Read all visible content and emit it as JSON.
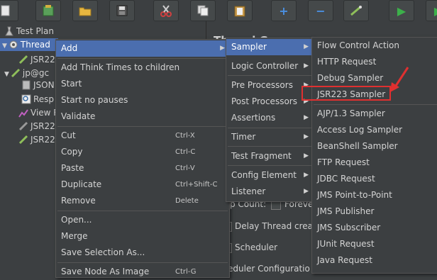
{
  "toolbar": {
    "buttons": [
      "new-icon",
      "templates-icon",
      "open-icon",
      "save-icon",
      "cut-icon",
      "copy-icon",
      "paste-icon",
      "expand-icon",
      "collapse-icon",
      "toggle-icon",
      "start-icon"
    ],
    "glyphs": {
      "expand": "+",
      "collapse": "−",
      "start": "▶"
    }
  },
  "tree": {
    "test_plan": "Test Plan",
    "thread": "Thread",
    "items": [
      "JSR22",
      "jp@gc",
      "JSON",
      "Resp",
      "View R",
      "JSR22",
      "JSR22"
    ]
  },
  "right_pane": {
    "title": "Thread G",
    "loop_count_label": "p Count:",
    "forever_label": "Foreve",
    "delay_label": "Delay Thread creati",
    "scheduler_label": "Scheduler",
    "scheduler_config_label": "eduler Configuratio",
    "partial_d": "d L"
  },
  "context_menu": {
    "items": [
      {
        "label": "Add",
        "submenu": true,
        "selected": true
      },
      {
        "label": "Add Think Times to children"
      },
      {
        "label": "Start"
      },
      {
        "label": "Start no pauses"
      },
      {
        "label": "Validate"
      },
      {
        "label": "Cut",
        "accel": "Ctrl-X"
      },
      {
        "label": "Copy",
        "accel": "Ctrl-C"
      },
      {
        "label": "Paste",
        "accel": "Ctrl-V"
      },
      {
        "label": "Duplicate",
        "accel": "Ctrl+Shift-C"
      },
      {
        "label": "Remove",
        "accel": "Delete"
      },
      {
        "label": "Open..."
      },
      {
        "label": "Merge"
      },
      {
        "label": "Save Selection As..."
      },
      {
        "label": "Save Node As Image",
        "accel": "Ctrl-G"
      }
    ]
  },
  "add_menu": {
    "items": [
      "Sampler",
      "Logic Controller",
      "Pre Processors",
      "Post Processors",
      "Assertions",
      "Timer",
      "Test Fragment",
      "Config Element",
      "Listener"
    ]
  },
  "sampler_menu": {
    "items": [
      "Flow Control Action",
      "HTTP Request",
      "Debug Sampler",
      "JSR223 Sampler",
      "AJP/1.3 Sampler",
      "Access Log Sampler",
      "BeanShell Sampler",
      "FTP Request",
      "JDBC Request",
      "JMS Point-to-Point",
      "JMS Publisher",
      "JMS Subscriber",
      "JUnit Request",
      "Java Request"
    ],
    "highlighted_item": "JSR223 Sampler"
  },
  "colors": {
    "background": "#3c3f41",
    "selection": "#4b6eaf",
    "highlight_box": "#e03030"
  }
}
